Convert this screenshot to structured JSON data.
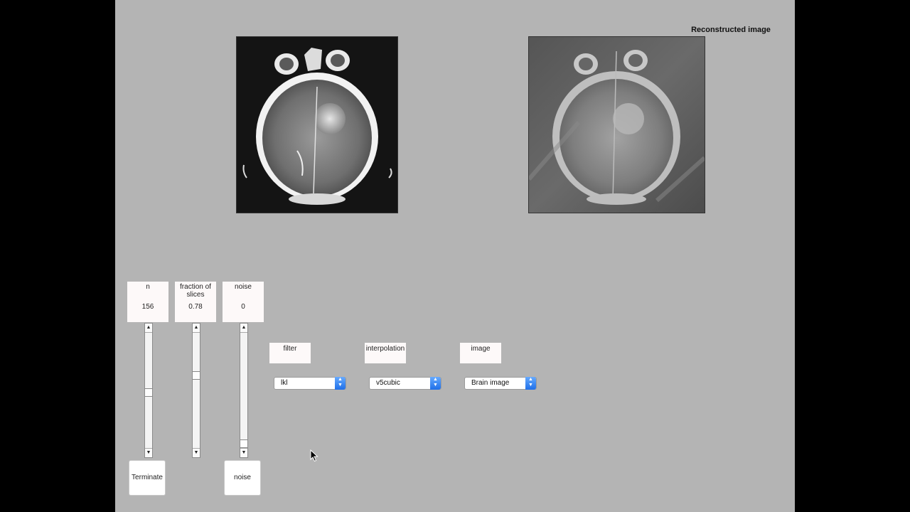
{
  "axes": {
    "reconstructed_title": "Reconstructed image"
  },
  "sliders": [
    {
      "label": "n",
      "value": "156",
      "level": 0.48
    },
    {
      "label": "fraction of slices",
      "value": "0.78",
      "level": 0.64
    },
    {
      "label": "noise",
      "value": "0",
      "level": 0.0
    }
  ],
  "controls": {
    "filter": {
      "label": "filter",
      "selected": "lkl"
    },
    "interpolation": {
      "label": "interpolation",
      "selected": "v5cubic"
    },
    "image": {
      "label": "image",
      "selected": "Brain image"
    }
  },
  "buttons": {
    "terminate": "Terminate",
    "noise": "noise"
  },
  "icons": {
    "arrow_up": "▲",
    "arrow_down": "▼",
    "popup": "chevron-updown-icon"
  },
  "colors": {
    "figure_bg": "#b4b4b4",
    "popup_accent": "#1f6fe8"
  }
}
